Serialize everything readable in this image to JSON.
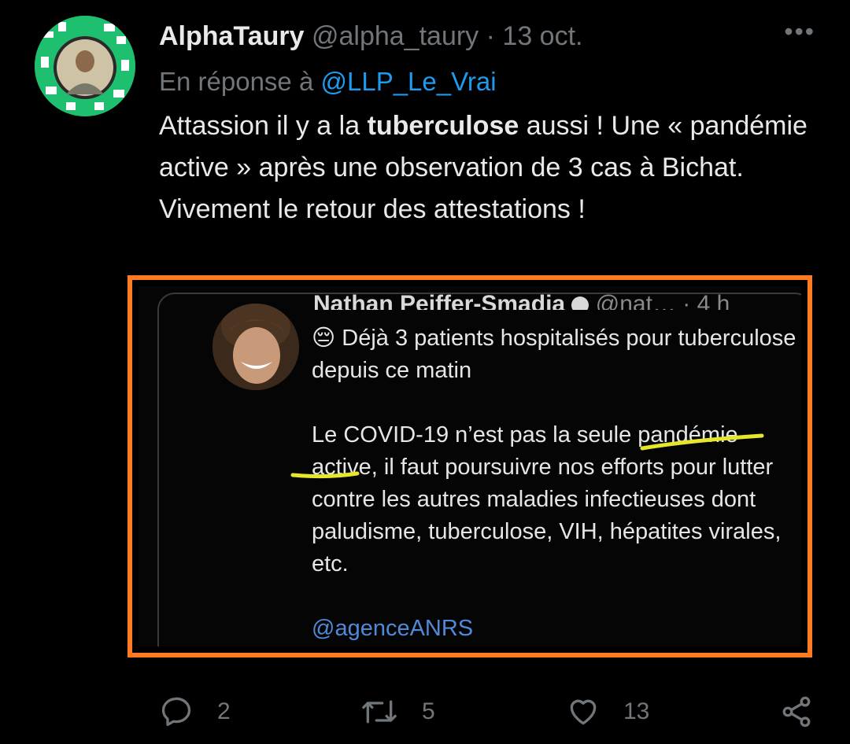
{
  "tweet": {
    "display_name": "AlphaTaury",
    "handle": "@alpha_taury",
    "separator": "·",
    "date": "13 oct.",
    "more": "•••",
    "reply_prefix": "En réponse à",
    "reply_to": "@LLP_Le_Vrai",
    "text_1": "Attassion il y a la ",
    "text_bold": "tuberculose",
    "text_2": " aussi ! Une « pandémie active » après une observation de 3 cas à Bichat.",
    "text_3": "Vivement le retour des attestations !"
  },
  "embedded": {
    "author": "Nathan Peiffer-Smadja",
    "handle": "@nat…",
    "time": "· 4 h",
    "emoji": "😔",
    "line_1": "Déjà 3 patients hospitalisés pour tuberculose depuis ce matin",
    "line_2": "Le COVID-19 n’est pas la seule pandémie active, il faut poursuivre nos efforts pour lutter contre les autres maladies infectieuses dont paludisme, tuberculose, VIH, hépatites virales, etc.",
    "mention": "@agenceANRS",
    "highlight_color": "#e6e62a",
    "frame_color": "#ff7a21"
  },
  "actions": {
    "reply_count": "2",
    "retweet_count": "5",
    "like_count": "13"
  }
}
